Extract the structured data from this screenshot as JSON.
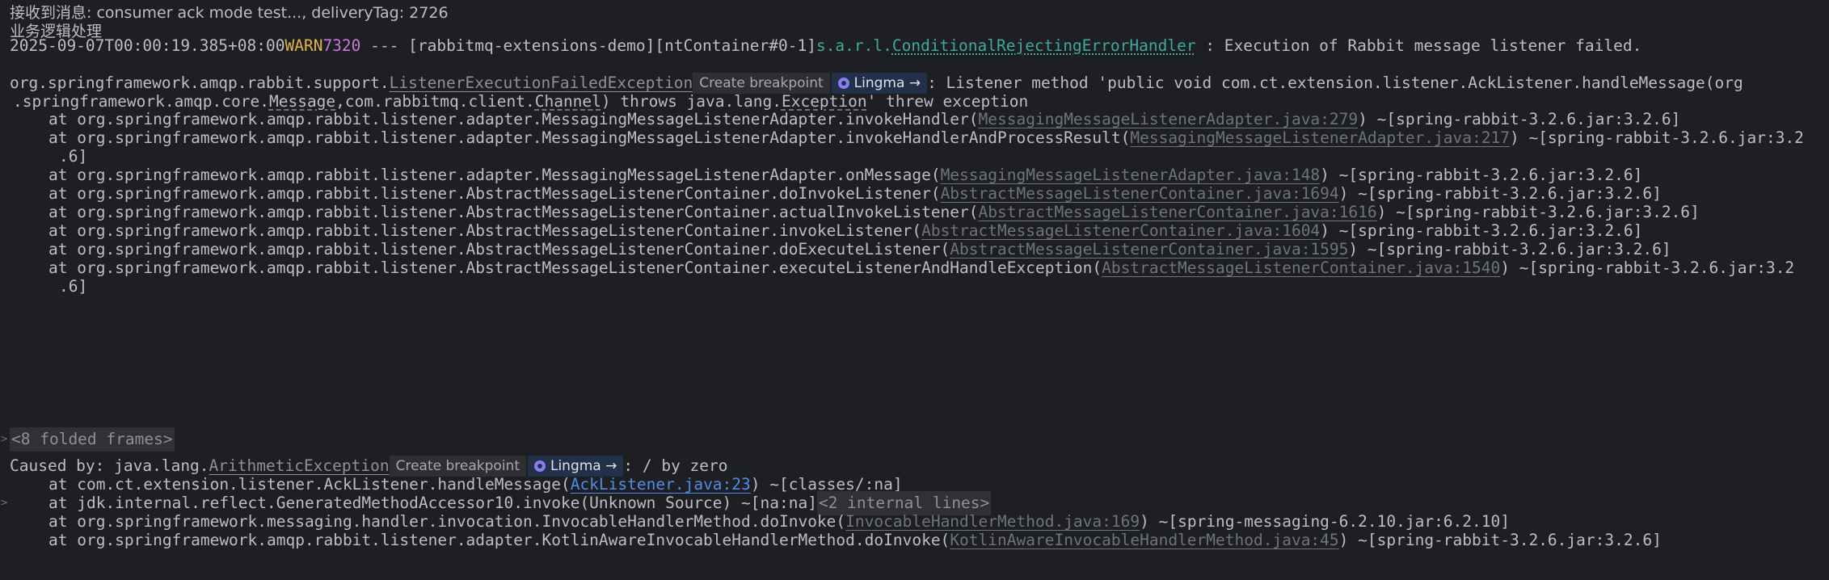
{
  "header": {
    "received": "接收到消息: consumer ack mode test..., deliveryTag: 2726",
    "business": "业务逻辑处理"
  },
  "log": {
    "timestamp": "2025-09-07T00:00:19.385+08:00",
    "level": "WARN",
    "pid": "7320",
    "sep": " --- ",
    "app": "[rabbitmq-extensions-demo]",
    "thread": "[ntContainer#0-1]",
    "logger_prefix": "s.a.r.l.",
    "logger_name": "ConditionalRejectingErrorHandler",
    "message": " : Execution of Rabbit message listener failed."
  },
  "exception": {
    "package": "org.springframework.amqp.rabbit.support.",
    "name": "ListenerExecutionFailedException",
    "message_1": ": Listener method 'public void com.ct.extension.listener.AckListener.handleMessage(org",
    "cont_1": ".springframework.amqp.core.",
    "cont_message": "Message",
    "cont_2": ",com.rabbitmq.client.",
    "cont_channel": "Channel",
    "cont_3": ") throws java.lang.",
    "cont_exception": "Exception",
    "cont_4": "' threw exception"
  },
  "chips": {
    "create_breakpoint": "Create breakpoint",
    "lingma": "Lingma →",
    "ai_icon": "lingma-ai-icon"
  },
  "frames": [
    {
      "method": "at org.springframework.amqp.rabbit.listener.adapter.MessagingMessageListenerAdapter.invokeHandler(",
      "file": "MessagingMessageListenerAdapter.java:279",
      "tail": ") ~[spring-rabbit-3.2.6.jar:3.2.6]"
    },
    {
      "method": "at org.springframework.amqp.rabbit.listener.adapter.MessagingMessageListenerAdapter.invokeHandlerAndProcessResult(",
      "file": "MessagingMessageListenerAdapter.java:217",
      "tail": ") ~[spring-rabbit-3.2.6.jar:3.2",
      "wrap": ".6]"
    },
    {
      "method": "at org.springframework.amqp.rabbit.listener.adapter.MessagingMessageListenerAdapter.onMessage(",
      "file": "MessagingMessageListenerAdapter.java:148",
      "tail": ") ~[spring-rabbit-3.2.6.jar:3.2.6]"
    },
    {
      "method": "at org.springframework.amqp.rabbit.listener.AbstractMessageListenerContainer.doInvokeListener(",
      "file": "AbstractMessageListenerContainer.java:1694",
      "tail": ") ~[spring-rabbit-3.2.6.jar:3.2.6]"
    },
    {
      "method": "at org.springframework.amqp.rabbit.listener.AbstractMessageListenerContainer.actualInvokeListener(",
      "file": "AbstractMessageListenerContainer.java:1616",
      "tail": ") ~[spring-rabbit-3.2.6.jar:3.2.6]"
    },
    {
      "method": "at org.springframework.amqp.rabbit.listener.AbstractMessageListenerContainer.invokeListener(",
      "file": "AbstractMessageListenerContainer.java:1604",
      "tail": ") ~[spring-rabbit-3.2.6.jar:3.2.6]"
    },
    {
      "method": "at org.springframework.amqp.rabbit.listener.AbstractMessageListenerContainer.doExecuteListener(",
      "file": "AbstractMessageListenerContainer.java:1595",
      "tail": ") ~[spring-rabbit-3.2.6.jar:3.2.6]"
    },
    {
      "method": "at org.springframework.amqp.rabbit.listener.AbstractMessageListenerContainer.executeListenerAndHandleException(",
      "file": "AbstractMessageListenerContainer.java:1540",
      "tail": ") ~[spring-rabbit-3.2.6.jar:3.2",
      "wrap": ".6]"
    }
  ],
  "folded": "<8 folded frames>",
  "caused": {
    "prefix": "Caused by: java.lang.",
    "name": "ArithmeticException",
    "message": ": / by zero"
  },
  "caused_frames": [
    {
      "method": "at com.ct.extension.listener.AckListener.handleMessage(",
      "file": "AckListener.java:23",
      "tail": ") ~[classes/:na]"
    },
    {
      "method": "at jdk.internal.reflect.GeneratedMethodAccessor10.invoke(Unknown Source) ~[na:na]",
      "internal": "<2 internal lines>"
    },
    {
      "method": "at org.springframework.messaging.handler.invocation.InvocableHandlerMethod.doInvoke(",
      "file": "InvocableHandlerMethod.java:169",
      "tail": ") ~[spring-messaging-6.2.10.jar:6.2.10]"
    },
    {
      "method": "at org.springframework.amqp.rabbit.listener.adapter.KotlinAwareInvocableHandlerMethod.doInvoke(",
      "file": "KotlinAwareInvocableHandlerMethod.java:45",
      "tail": ") ~[spring-rabbit-3.2.6.jar:3.2.6]"
    }
  ],
  "icons": {
    "expand": "chevron-right-icon"
  }
}
